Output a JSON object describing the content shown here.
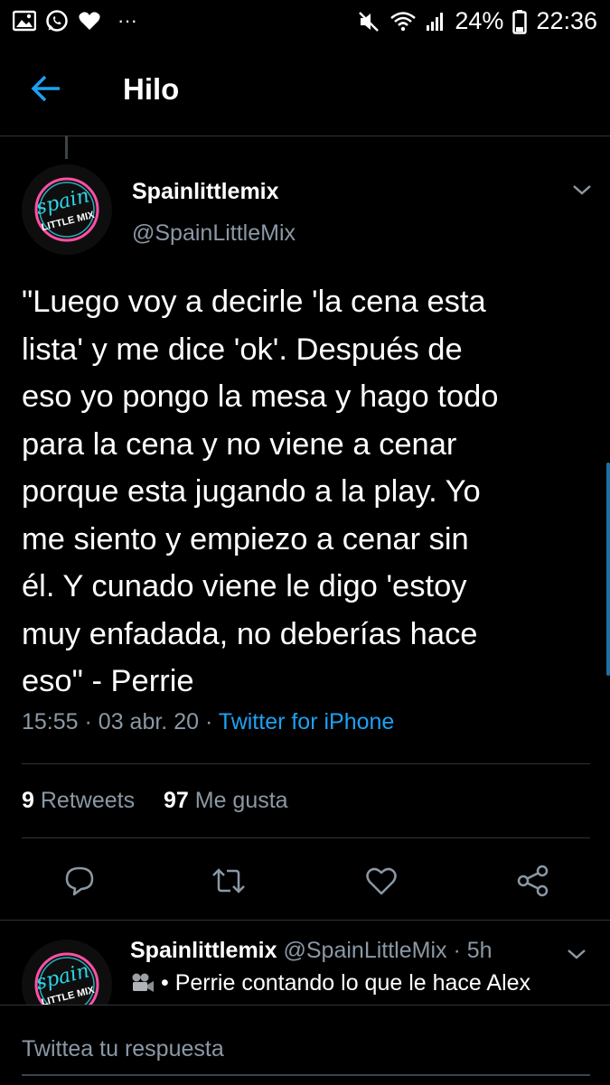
{
  "status_bar": {
    "battery": "24%",
    "time": "22:36",
    "dots": "···"
  },
  "header": {
    "title": "Hilo"
  },
  "tweet": {
    "author_name": "Spainlittlemix",
    "author_handle": "@SpainLittleMix",
    "avatar_text_top": "spain",
    "avatar_text_bottom": "LITTLE MIX",
    "text_lines": [
      "\"Luego voy a decirle 'la cena esta",
      "lista' y me dice 'ok'. Después de",
      "eso yo pongo la mesa y hago todo",
      "para la cena y no viene a cenar",
      "porque esta jugando a la play. Yo",
      "me siento y empiezo a cenar sin",
      "él. Y cunado viene le digo 'estoy",
      "muy enfadada, no deberías hace",
      "eso\" - Perrie"
    ],
    "time": "15:55",
    "date": "03 abr. 20",
    "source": "Twitter for iPhone",
    "separator": "·",
    "retweets_count": "9",
    "retweets_label": "Retweets",
    "likes_count": "97",
    "likes_label": "Me gusta"
  },
  "reply_tweet": {
    "author_name": "Spainlittlemix",
    "author_handle": "@SpainLittleMix",
    "time": "5h",
    "separator": "·",
    "text": "• Perrie contando lo que le hace Alex"
  },
  "reply_bar": {
    "placeholder": "Twittea tu respuesta"
  },
  "colors": {
    "accent": "#1da1f2",
    "secondary_text": "#8b98a5",
    "background": "#000000",
    "avatar_pink": "#ff4fa3",
    "avatar_cyan": "#2fd6e8"
  }
}
